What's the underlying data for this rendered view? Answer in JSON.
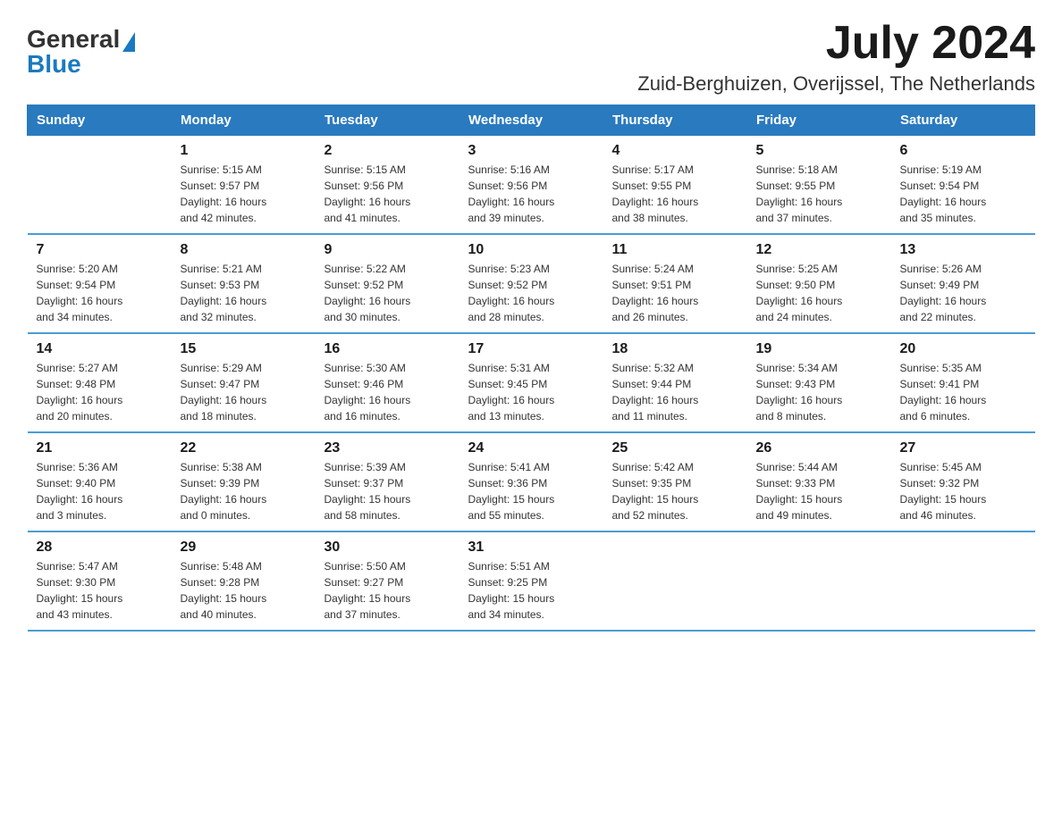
{
  "logo": {
    "general": "General",
    "blue": "Blue"
  },
  "title": {
    "month_year": "July 2024",
    "location": "Zuid-Berghuizen, Overijssel, The Netherlands"
  },
  "header_days": [
    "Sunday",
    "Monday",
    "Tuesday",
    "Wednesday",
    "Thursday",
    "Friday",
    "Saturday"
  ],
  "weeks": [
    [
      {
        "day": "",
        "info": ""
      },
      {
        "day": "1",
        "info": "Sunrise: 5:15 AM\nSunset: 9:57 PM\nDaylight: 16 hours\nand 42 minutes."
      },
      {
        "day": "2",
        "info": "Sunrise: 5:15 AM\nSunset: 9:56 PM\nDaylight: 16 hours\nand 41 minutes."
      },
      {
        "day": "3",
        "info": "Sunrise: 5:16 AM\nSunset: 9:56 PM\nDaylight: 16 hours\nand 39 minutes."
      },
      {
        "day": "4",
        "info": "Sunrise: 5:17 AM\nSunset: 9:55 PM\nDaylight: 16 hours\nand 38 minutes."
      },
      {
        "day": "5",
        "info": "Sunrise: 5:18 AM\nSunset: 9:55 PM\nDaylight: 16 hours\nand 37 minutes."
      },
      {
        "day": "6",
        "info": "Sunrise: 5:19 AM\nSunset: 9:54 PM\nDaylight: 16 hours\nand 35 minutes."
      }
    ],
    [
      {
        "day": "7",
        "info": "Sunrise: 5:20 AM\nSunset: 9:54 PM\nDaylight: 16 hours\nand 34 minutes."
      },
      {
        "day": "8",
        "info": "Sunrise: 5:21 AM\nSunset: 9:53 PM\nDaylight: 16 hours\nand 32 minutes."
      },
      {
        "day": "9",
        "info": "Sunrise: 5:22 AM\nSunset: 9:52 PM\nDaylight: 16 hours\nand 30 minutes."
      },
      {
        "day": "10",
        "info": "Sunrise: 5:23 AM\nSunset: 9:52 PM\nDaylight: 16 hours\nand 28 minutes."
      },
      {
        "day": "11",
        "info": "Sunrise: 5:24 AM\nSunset: 9:51 PM\nDaylight: 16 hours\nand 26 minutes."
      },
      {
        "day": "12",
        "info": "Sunrise: 5:25 AM\nSunset: 9:50 PM\nDaylight: 16 hours\nand 24 minutes."
      },
      {
        "day": "13",
        "info": "Sunrise: 5:26 AM\nSunset: 9:49 PM\nDaylight: 16 hours\nand 22 minutes."
      }
    ],
    [
      {
        "day": "14",
        "info": "Sunrise: 5:27 AM\nSunset: 9:48 PM\nDaylight: 16 hours\nand 20 minutes."
      },
      {
        "day": "15",
        "info": "Sunrise: 5:29 AM\nSunset: 9:47 PM\nDaylight: 16 hours\nand 18 minutes."
      },
      {
        "day": "16",
        "info": "Sunrise: 5:30 AM\nSunset: 9:46 PM\nDaylight: 16 hours\nand 16 minutes."
      },
      {
        "day": "17",
        "info": "Sunrise: 5:31 AM\nSunset: 9:45 PM\nDaylight: 16 hours\nand 13 minutes."
      },
      {
        "day": "18",
        "info": "Sunrise: 5:32 AM\nSunset: 9:44 PM\nDaylight: 16 hours\nand 11 minutes."
      },
      {
        "day": "19",
        "info": "Sunrise: 5:34 AM\nSunset: 9:43 PM\nDaylight: 16 hours\nand 8 minutes."
      },
      {
        "day": "20",
        "info": "Sunrise: 5:35 AM\nSunset: 9:41 PM\nDaylight: 16 hours\nand 6 minutes."
      }
    ],
    [
      {
        "day": "21",
        "info": "Sunrise: 5:36 AM\nSunset: 9:40 PM\nDaylight: 16 hours\nand 3 minutes."
      },
      {
        "day": "22",
        "info": "Sunrise: 5:38 AM\nSunset: 9:39 PM\nDaylight: 16 hours\nand 0 minutes."
      },
      {
        "day": "23",
        "info": "Sunrise: 5:39 AM\nSunset: 9:37 PM\nDaylight: 15 hours\nand 58 minutes."
      },
      {
        "day": "24",
        "info": "Sunrise: 5:41 AM\nSunset: 9:36 PM\nDaylight: 15 hours\nand 55 minutes."
      },
      {
        "day": "25",
        "info": "Sunrise: 5:42 AM\nSunset: 9:35 PM\nDaylight: 15 hours\nand 52 minutes."
      },
      {
        "day": "26",
        "info": "Sunrise: 5:44 AM\nSunset: 9:33 PM\nDaylight: 15 hours\nand 49 minutes."
      },
      {
        "day": "27",
        "info": "Sunrise: 5:45 AM\nSunset: 9:32 PM\nDaylight: 15 hours\nand 46 minutes."
      }
    ],
    [
      {
        "day": "28",
        "info": "Sunrise: 5:47 AM\nSunset: 9:30 PM\nDaylight: 15 hours\nand 43 minutes."
      },
      {
        "day": "29",
        "info": "Sunrise: 5:48 AM\nSunset: 9:28 PM\nDaylight: 15 hours\nand 40 minutes."
      },
      {
        "day": "30",
        "info": "Sunrise: 5:50 AM\nSunset: 9:27 PM\nDaylight: 15 hours\nand 37 minutes."
      },
      {
        "day": "31",
        "info": "Sunrise: 5:51 AM\nSunset: 9:25 PM\nDaylight: 15 hours\nand 34 minutes."
      },
      {
        "day": "",
        "info": ""
      },
      {
        "day": "",
        "info": ""
      },
      {
        "day": "",
        "info": ""
      }
    ]
  ]
}
